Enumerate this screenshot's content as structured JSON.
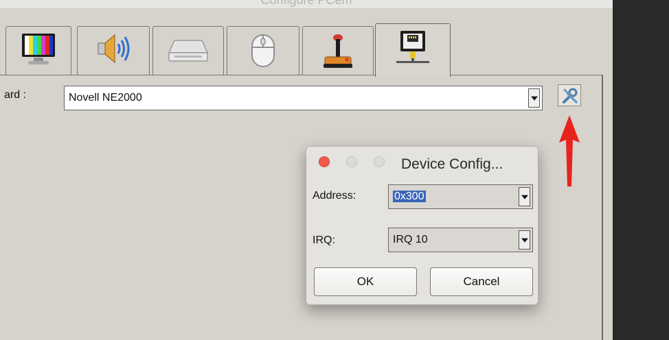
{
  "window": {
    "title": "Configure PCem"
  },
  "tabs": [
    {
      "name": "display",
      "icon": "monitor-icon"
    },
    {
      "name": "sound",
      "icon": "speaker-icon"
    },
    {
      "name": "storage",
      "icon": "drive-icon"
    },
    {
      "name": "input",
      "icon": "mouse-icon"
    },
    {
      "name": "joystick",
      "icon": "joystick-icon"
    },
    {
      "name": "network",
      "icon": "network-icon",
      "active": true
    }
  ],
  "network": {
    "card_label": "ard :",
    "card_value": "Novell NE2000",
    "configure_icon": "tools-icon"
  },
  "dialog": {
    "title": "Device Config...",
    "address_label": "Address:",
    "address_value": "0x300",
    "irq_label": "IRQ:",
    "irq_value": "IRQ 10",
    "ok_label": "OK",
    "cancel_label": "Cancel"
  },
  "colors": {
    "window_bg": "#d6d2cc",
    "dialog_bg": "#e5e3df",
    "close_red": "#f05a4e",
    "selection_blue": "#3b66b8",
    "annotation_arrow": "#e8231c"
  }
}
